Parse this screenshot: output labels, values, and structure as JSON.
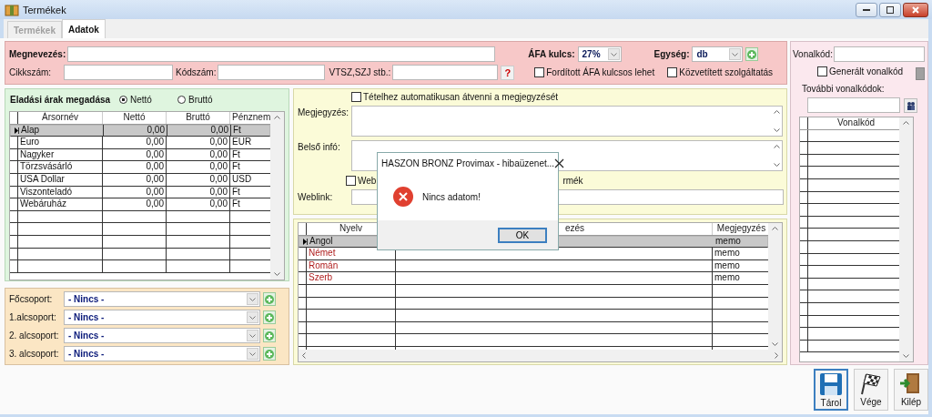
{
  "window": {
    "title": "Termékek"
  },
  "tabs": [
    {
      "label": "Termékek",
      "selected": false,
      "disabled": true
    },
    {
      "label": "Adatok",
      "selected": true,
      "disabled": false
    }
  ],
  "top_panel": {
    "name_label": "Megnevezés:",
    "sku_label": "Cikkszám:",
    "code_label": "Kódszám:",
    "vtsz_label": "VTSZ,SZJ stb.:",
    "help_button": "?",
    "vat": {
      "label": "ÁFA kulcs:",
      "value": "27%"
    },
    "unit": {
      "label": "Egység:",
      "value": "db"
    },
    "checkboxes": [
      {
        "label": "Fordított ÁFA kulcsos lehet",
        "checked": false
      },
      {
        "label": "Közvetített szolgáltatás",
        "checked": false
      }
    ]
  },
  "prices": {
    "title": "Eladási árak megadása",
    "modes": [
      {
        "label": "Nettó",
        "selected": true
      },
      {
        "label": "Bruttó",
        "selected": false
      }
    ],
    "columns": [
      "Ársornév",
      "Nettó",
      "Bruttó",
      "Pénznem"
    ],
    "rows": [
      {
        "cells": [
          "Alap",
          "0,00",
          "0,00",
          "Ft"
        ],
        "selected": true
      },
      {
        "cells": [
          "Euro",
          "0,00",
          "0,00",
          "EUR"
        ],
        "selected": false
      },
      {
        "cells": [
          "Nagyker",
          "0,00",
          "0,00",
          "Ft"
        ],
        "selected": false
      },
      {
        "cells": [
          "Törzsvásárló",
          "0,00",
          "0,00",
          "Ft"
        ],
        "selected": false
      },
      {
        "cells": [
          "USA Dollar",
          "0,00",
          "0,00",
          "USD"
        ],
        "selected": false
      },
      {
        "cells": [
          "Viszonteladó",
          "0,00",
          "0,00",
          "Ft"
        ],
        "selected": false
      },
      {
        "cells": [
          "Webáruház",
          "0,00",
          "0,00",
          "Ft"
        ],
        "selected": false
      }
    ]
  },
  "groups": [
    {
      "label": "Főcsoport:",
      "value": "- Nincs -"
    },
    {
      "label": "1.alcsoport:",
      "value": "- Nincs -"
    },
    {
      "label": "2. alcsoport:",
      "value": "- Nincs -"
    },
    {
      "label": "3. alcsoport:",
      "value": "- Nincs -"
    }
  ],
  "notes": {
    "auto_checkbox": {
      "label": "Tételhez automatikusan átvenni a megjegyzését",
      "checked": false
    },
    "remark_label": "Megjegyzés:",
    "internal_label": "Belső infó:",
    "web_checkbox": {
      "label": "Web",
      "checked": false
    },
    "web_checkbox_tail": "rmék",
    "weblink_label": "Weblink:"
  },
  "languages": {
    "columns": [
      "Nyelv",
      "ezés",
      "Megjegyzés"
    ],
    "rows": [
      {
        "language": "Angol",
        "note": "memo",
        "selected": true,
        "translated": true
      },
      {
        "language": "Német",
        "note": "memo",
        "selected": false,
        "translated": false
      },
      {
        "language": "Román",
        "note": "memo",
        "selected": false,
        "translated": false
      },
      {
        "language": "Szerb",
        "note": "memo",
        "selected": false,
        "translated": false
      }
    ]
  },
  "barcode": {
    "label": "Vonalkód:",
    "generated": {
      "label": "Generált vonalkód",
      "checked": false
    },
    "more_label": "További vonalkódok:",
    "column": "Vonalkód"
  },
  "actions": [
    {
      "label": "Tárol",
      "kind": "save",
      "focused": true
    },
    {
      "label": "Vége",
      "kind": "finish",
      "focused": false
    },
    {
      "label": "Kilép",
      "kind": "exit",
      "focused": false
    }
  ],
  "dialog": {
    "title": "HASZON BRONZ Provimax - hibaüzenet...",
    "message": "Nincs adatom!",
    "button": "OK"
  }
}
